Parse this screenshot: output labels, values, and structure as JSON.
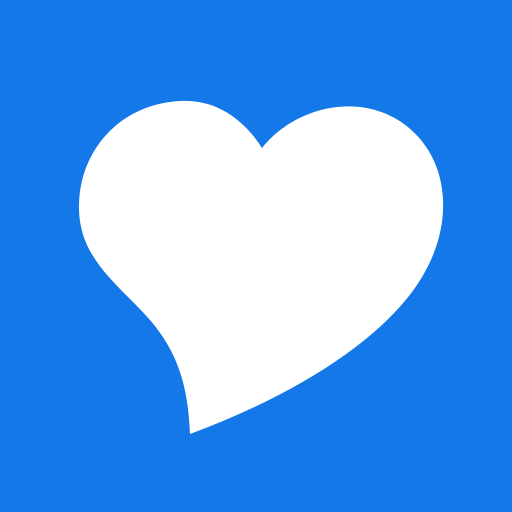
{
  "icon": {
    "name": "heart-icon",
    "background_color": "#1478e8",
    "foreground_color": "#ffffff"
  }
}
